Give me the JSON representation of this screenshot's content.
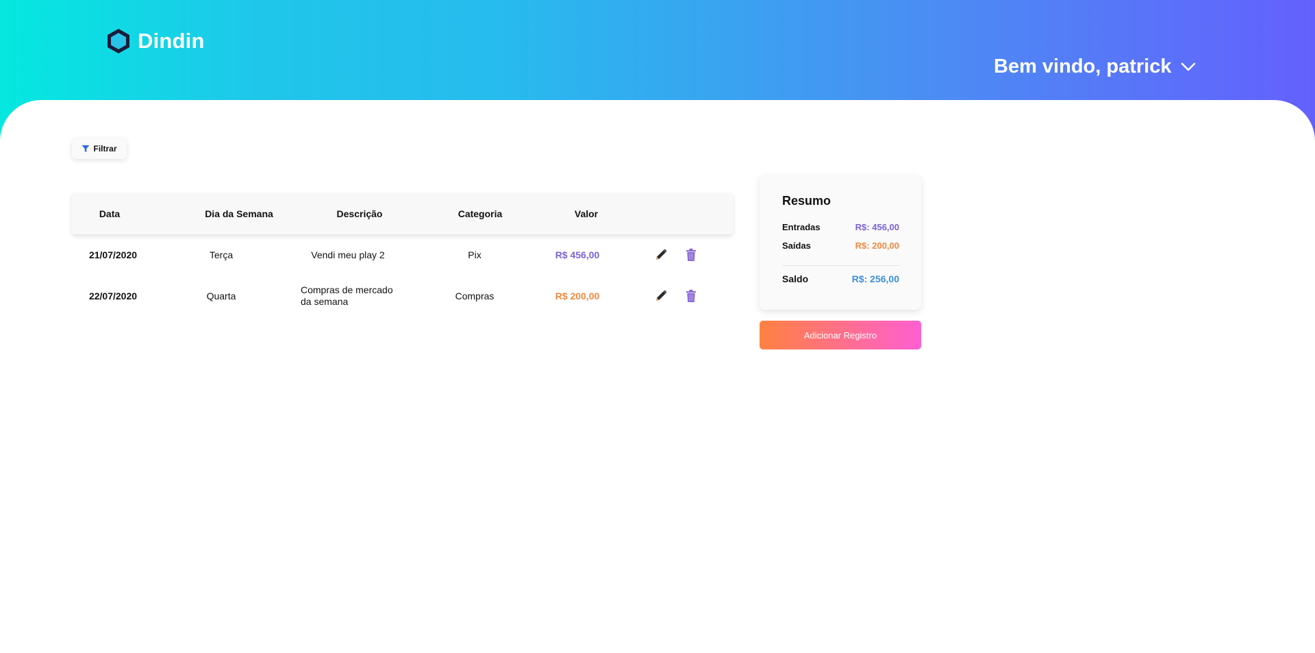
{
  "app": {
    "name": "Dindin"
  },
  "header": {
    "welcome": "Bem vindo, patrick",
    "dropdown_icon": "chevron-down-icon"
  },
  "toolbar": {
    "filter_label": "Filtrar",
    "filter_icon": "filter-icon"
  },
  "table": {
    "headers": [
      "Data",
      "Dia da Semana",
      "Descrição",
      "Categoria",
      "Valor"
    ],
    "rows": [
      {
        "date": "21/07/2020",
        "weekday": "Terça",
        "description": "Vendi meu play 2",
        "category": "Pix",
        "value": "R$ 456,00",
        "type": "in"
      },
      {
        "date": "22/07/2020",
        "weekday": "Quarta",
        "description": "Compras de mercado da semana",
        "category": "Compras",
        "value": "R$ 200,00",
        "type": "out"
      }
    ],
    "action_icons": [
      "pencil-icon",
      "trash-icon"
    ]
  },
  "summary": {
    "title": "Resumo",
    "entradas_label": "Entradas",
    "entradas_value": "R$: 456,00",
    "saidas_label": "Saídas",
    "saidas_value": "R$: 200,00",
    "saldo_label": "Saldo",
    "saldo_value": "R$: 256,00"
  },
  "add_button": {
    "label": "Adicionar Registro"
  },
  "colors": {
    "in": "#7b62d9",
    "out": "#f0883f",
    "saldo": "#3a8fe0",
    "trash": "#8a6ad6"
  }
}
